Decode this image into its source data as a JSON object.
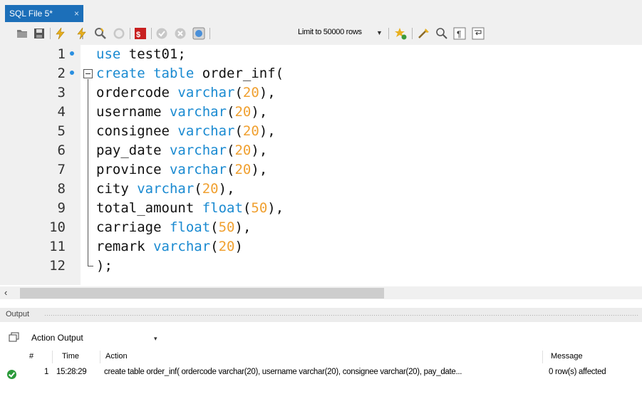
{
  "tab": {
    "title": "SQL File 5*",
    "close": "×"
  },
  "toolbar": {
    "limit_label": "Limit to 50000 rows",
    "icons": [
      "open-folder-icon",
      "save-icon",
      "execute-icon",
      "execute-current-icon",
      "explain-icon",
      "stop-icon",
      "toggle-error-icon",
      "commit-icon",
      "rollback-icon",
      "autocommit-icon",
      "bookmark-icon",
      "beautify-icon",
      "find-icon",
      "invisible-chars-icon",
      "word-wrap-icon"
    ]
  },
  "editor": {
    "lines": [
      {
        "num": "1"
      },
      {
        "num": "2"
      },
      {
        "num": "3"
      },
      {
        "num": "4"
      },
      {
        "num": "5"
      },
      {
        "num": "6"
      },
      {
        "num": "7"
      },
      {
        "num": "8"
      },
      {
        "num": "9"
      },
      {
        "num": "10"
      },
      {
        "num": "11"
      },
      {
        "num": "12"
      }
    ],
    "code": {
      "l1_kw": "use",
      "l1_rest": " test01;",
      "l2_kw": "create table",
      "l2_rest": " order_inf(",
      "l3_name": "ordercode ",
      "l3_type": "varchar",
      "l3_len": "20",
      "l3_end": "),",
      "l4_name": "username ",
      "l4_type": "varchar",
      "l4_len": "20",
      "l4_end": "),",
      "l5_name": "consignee ",
      "l5_type": "varchar",
      "l5_len": "20",
      "l5_end": "),",
      "l6_name": "pay_date ",
      "l6_type": "varchar",
      "l6_len": "20",
      "l6_end": "),",
      "l7_name": "province ",
      "l7_type": "varchar",
      "l7_len": "20",
      "l7_end": "),",
      "l8_name": "city ",
      "l8_type": "varchar",
      "l8_len": "20",
      "l8_end": "),",
      "l9_name": "total_amount ",
      "l9_type": "float",
      "l9_len": "50",
      "l9_end": "),",
      "l10_name": "carriage ",
      "l10_type": "float",
      "l10_len": "50",
      "l10_end": "),",
      "l11_name": "remark ",
      "l11_type": "varchar",
      "l11_len": "20",
      "l11_end": ")",
      "l12": ");"
    },
    "paren_open": "("
  },
  "scrollbar": {
    "left_arrow": "‹"
  },
  "output": {
    "title": "Output",
    "selector": "Action Output",
    "selector_arrow": "▾",
    "columns": {
      "num": "#",
      "time": "Time",
      "action": "Action",
      "message": "Message"
    },
    "rows": [
      {
        "num": "1",
        "time": "15:28:29",
        "action": "create table order_inf( ordercode varchar(20), username varchar(20), consignee varchar(20), pay_date...",
        "message": "0 row(s) affected"
      }
    ]
  }
}
